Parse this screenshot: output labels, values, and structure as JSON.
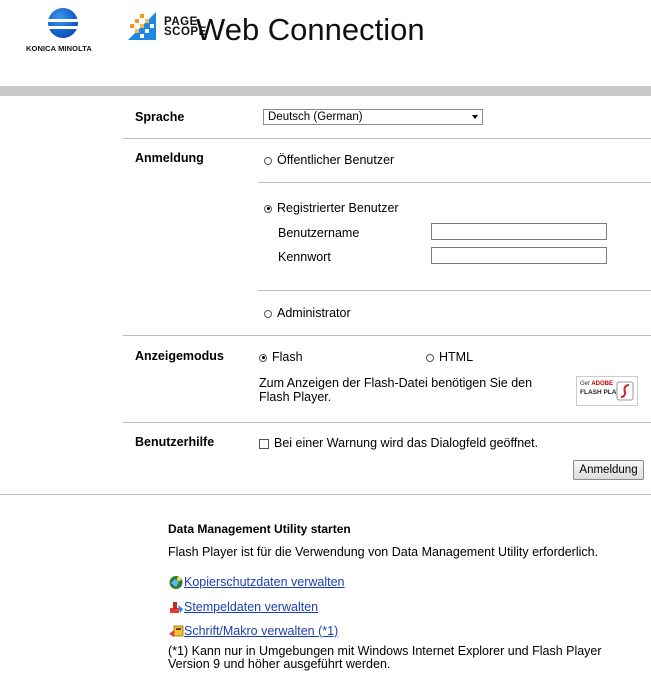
{
  "header": {
    "brand": "KONICA MINOLTA",
    "pagescope_top": "PAGE",
    "pagescope_bottom": "SCOPE",
    "product": "Web Connection"
  },
  "form": {
    "language": {
      "label": "Sprache",
      "selected": "Deutsch (German)"
    },
    "login": {
      "label": "Anmeldung",
      "option_public": "Öffentlicher Benutzer",
      "option_registered": "Registrierter Benutzer",
      "username_label": "Benutzername",
      "username_value": "",
      "password_label": "Kennwort",
      "password_value": "",
      "option_admin": "Administrator",
      "selected": "registered"
    },
    "display_mode": {
      "label": "Anzeigemodus",
      "option_flash": "Flash",
      "option_html": "HTML",
      "selected": "flash",
      "note": "Zum Anzeigen der Flash-Datei benötigen Sie den Flash Player.",
      "badge_line1_prefix": "Get",
      "badge_line1_brand": "ADOBE",
      "badge_line2": "FLASH PLAYER"
    },
    "user_help": {
      "label": "Benutzerhilfe",
      "checkbox_text": "Bei einer Warnung wird das Dialogfeld geöffnet.",
      "checked": false
    },
    "submit_label": "Anmeldung"
  },
  "utility": {
    "title": "Data Management Utility starten",
    "subtitle": "Flash Player ist für die Verwendung von Data Management Utility erforderlich.",
    "links": [
      {
        "label": "Kopierschutzdaten verwalten",
        "icon": "copy-protect-icon"
      },
      {
        "label": "Stempeldaten verwalten",
        "icon": "stamp-icon"
      },
      {
        "label": "Schrift/Makro verwalten (*1)",
        "icon": "font-macro-icon"
      }
    ],
    "footnote": "(*1) Kann nur in Umgebungen mit Windows Internet Explorer und Flash Player Version 9 und höher ausgeführt werden."
  },
  "colors": {
    "link": "#1a3fb5",
    "brand_blue": "#1560c8",
    "header_bar": "#c8c8c8"
  }
}
